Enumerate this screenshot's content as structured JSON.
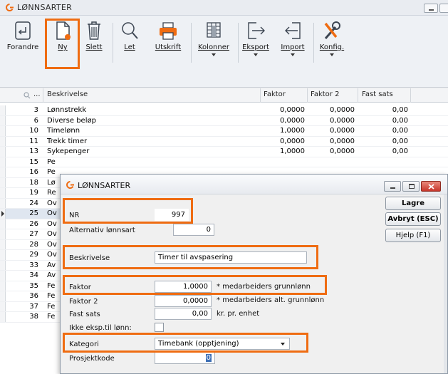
{
  "window": {
    "title": "LØNNSARTER"
  },
  "toolbar": [
    {
      "id": "forandre",
      "label": "Forandre",
      "icon": "edit-icon"
    },
    {
      "id": "ny",
      "label": "Ny",
      "icon": "new-document-icon"
    },
    {
      "id": "slett",
      "label": "Slett",
      "icon": "trash-icon"
    },
    {
      "id": "let",
      "label": "Let",
      "icon": "search-icon"
    },
    {
      "id": "utskrift",
      "label": "Utskrift",
      "icon": "printer-icon"
    },
    {
      "id": "kolonner",
      "label": "Kolonner",
      "icon": "columns-icon"
    },
    {
      "id": "eksport",
      "label": "Eksport",
      "icon": "export-icon"
    },
    {
      "id": "import",
      "label": "Import",
      "icon": "import-icon"
    },
    {
      "id": "konfig",
      "label": "Konfig.",
      "icon": "tools-icon"
    }
  ],
  "grid": {
    "search_glyph": "...",
    "columns": [
      "Beskrivelse",
      "Faktor",
      "Faktor 2",
      "Fast sats"
    ],
    "rows": [
      {
        "nr": "3",
        "desc": "Lønnstrekk",
        "faktor": "0,0000",
        "faktor2": "0,0000",
        "fastsats": "0,00"
      },
      {
        "nr": "6",
        "desc": "Diverse beløp",
        "faktor": "0,0000",
        "faktor2": "0,0000",
        "fastsats": "0,00"
      },
      {
        "nr": "10",
        "desc": "Timelønn",
        "faktor": "1,0000",
        "faktor2": "0,0000",
        "fastsats": "0,00"
      },
      {
        "nr": "11",
        "desc": "Trekk timer",
        "faktor": "0,0000",
        "faktor2": "0,0000",
        "fastsats": "0,00"
      },
      {
        "nr": "13",
        "desc": "Sykepenger",
        "faktor": "1,0000",
        "faktor2": "0,0000",
        "fastsats": "0,00"
      },
      {
        "nr": "15",
        "desc": "Pe",
        "faktor": "",
        "faktor2": "",
        "fastsats": ""
      },
      {
        "nr": "16",
        "desc": "Pe",
        "faktor": "",
        "faktor2": "",
        "fastsats": ""
      },
      {
        "nr": "18",
        "desc": "Lø",
        "faktor": "",
        "faktor2": "",
        "fastsats": ""
      },
      {
        "nr": "19",
        "desc": "Re",
        "faktor": "",
        "faktor2": "",
        "fastsats": ""
      },
      {
        "nr": "24",
        "desc": "Ov",
        "faktor": "",
        "faktor2": "",
        "fastsats": ""
      },
      {
        "nr": "25",
        "desc": "Ov",
        "faktor": "",
        "faktor2": "",
        "fastsats": "",
        "selected": true
      },
      {
        "nr": "26",
        "desc": "Ov",
        "faktor": "",
        "faktor2": "",
        "fastsats": ""
      },
      {
        "nr": "27",
        "desc": "Ov",
        "faktor": "",
        "faktor2": "",
        "fastsats": ""
      },
      {
        "nr": "28",
        "desc": "Ov",
        "faktor": "",
        "faktor2": "",
        "fastsats": ""
      },
      {
        "nr": "29",
        "desc": "Ov",
        "faktor": "",
        "faktor2": "",
        "fastsats": ""
      },
      {
        "nr": "33",
        "desc": "Av",
        "faktor": "",
        "faktor2": "",
        "fastsats": ""
      },
      {
        "nr": "34",
        "desc": "Av",
        "faktor": "",
        "faktor2": "",
        "fastsats": ""
      },
      {
        "nr": "35",
        "desc": "Fe",
        "faktor": "",
        "faktor2": "",
        "fastsats": ""
      },
      {
        "nr": "36",
        "desc": "Fe",
        "faktor": "",
        "faktor2": "",
        "fastsats": ""
      },
      {
        "nr": "37",
        "desc": "Fe",
        "faktor": "",
        "faktor2": "",
        "fastsats": ""
      },
      {
        "nr": "38",
        "desc": "Fe",
        "faktor": "",
        "faktor2": "",
        "fastsats": ""
      }
    ]
  },
  "dialog": {
    "title": "LØNNSARTER",
    "nr_label": "NR",
    "nr_value": "997",
    "alt_label": "Alternativ lønnsart",
    "alt_value": "0",
    "desc_label": "Beskrivelse",
    "desc_value": "Timer til avspasering",
    "faktor_label": "Faktor",
    "faktor_value": "1,0000",
    "faktor_suffix": "* medarbeiders grunnlønn",
    "faktor2_label": "Faktor 2",
    "faktor2_value": "0,0000",
    "faktor2_suffix": "* medarbeiders alt. grunnlønn",
    "fastsats_label": "Fast sats",
    "fastsats_value": "0,00",
    "fastsats_suffix": "kr. pr. enhet",
    "ikke_label": "Ikke eksp.til lønn:",
    "kategori_label": "Kategori",
    "kategori_value": "Timebank (opptjening)",
    "prosjekt_label": "Prosjektkode",
    "prosjekt_value": "0",
    "buttons": {
      "lagre": "Lagre",
      "avbryt": "Avbryt (ESC)",
      "hjelp": "Hjelp (F1)"
    }
  },
  "colors": {
    "highlight": "#ef6c12",
    "logo": "#ef6c12",
    "close": "#d9432f"
  }
}
